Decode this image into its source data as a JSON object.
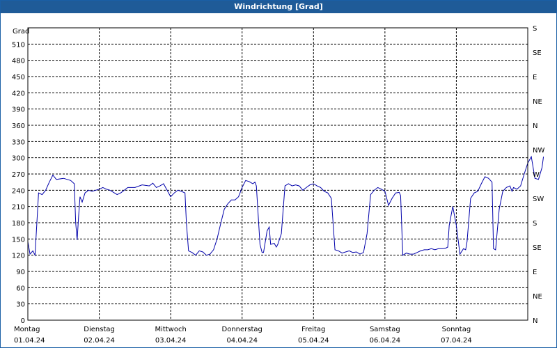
{
  "window": {
    "title": "Windrichtung [Grad]"
  },
  "chart_data": {
    "type": "line",
    "title": "Windrichtung [Grad]",
    "ylabel": "Grad",
    "ylim": [
      0,
      540
    ],
    "y_ticks": [
      0,
      30,
      60,
      90,
      120,
      150,
      180,
      210,
      240,
      270,
      300,
      330,
      360,
      390,
      420,
      450,
      480,
      510
    ],
    "y2_ticks": [
      {
        "value": 0,
        "label": "N"
      },
      {
        "value": 45,
        "label": "NE"
      },
      {
        "value": 90,
        "label": "E"
      },
      {
        "value": 135,
        "label": "SE"
      },
      {
        "value": 180,
        "label": "S"
      },
      {
        "value": 225,
        "label": "SW"
      },
      {
        "value": 270,
        "label": "W"
      },
      {
        "value": 315,
        "label": "NW"
      },
      {
        "value": 360,
        "label": "N"
      },
      {
        "value": 405,
        "label": "NE"
      },
      {
        "value": 450,
        "label": "E"
      },
      {
        "value": 495,
        "label": "SE"
      },
      {
        "value": 540,
        "label": "S"
      }
    ],
    "x_range": [
      0,
      7
    ],
    "x_ticks": [
      {
        "day": "Montag",
        "date": "01.04.24"
      },
      {
        "day": "Dienstag",
        "date": "02.04.24"
      },
      {
        "day": "Mittwoch",
        "date": "03.04.24"
      },
      {
        "day": "Donnerstag",
        "date": "04.04.24"
      },
      {
        "day": "Freitag",
        "date": "05.04.24"
      },
      {
        "day": "Samstag",
        "date": "06.04.24"
      },
      {
        "day": "Sonntag",
        "date": "07.04.24"
      }
    ],
    "grid": true,
    "series": [
      {
        "color": "#0000aa",
        "points": [
          [
            0.0,
            145
          ],
          [
            0.03,
            122
          ],
          [
            0.07,
            128
          ],
          [
            0.1,
            120
          ],
          [
            0.15,
            235
          ],
          [
            0.2,
            232
          ],
          [
            0.25,
            240
          ],
          [
            0.3,
            255
          ],
          [
            0.35,
            268
          ],
          [
            0.4,
            260
          ],
          [
            0.5,
            262
          ],
          [
            0.6,
            258
          ],
          [
            0.65,
            252
          ],
          [
            0.67,
            180
          ],
          [
            0.69,
            148
          ],
          [
            0.71,
            190
          ],
          [
            0.73,
            228
          ],
          [
            0.76,
            218
          ],
          [
            0.8,
            235
          ],
          [
            0.85,
            240
          ],
          [
            0.9,
            238
          ],
          [
            1.0,
            242
          ],
          [
            1.05,
            245
          ],
          [
            1.1,
            242
          ],
          [
            1.15,
            240
          ],
          [
            1.2,
            236
          ],
          [
            1.25,
            232
          ],
          [
            1.3,
            235
          ],
          [
            1.35,
            240
          ],
          [
            1.4,
            245
          ],
          [
            1.5,
            245
          ],
          [
            1.6,
            250
          ],
          [
            1.7,
            248
          ],
          [
            1.75,
            253
          ],
          [
            1.8,
            245
          ],
          [
            1.85,
            248
          ],
          [
            1.9,
            252
          ],
          [
            1.95,
            240
          ],
          [
            2.0,
            228
          ],
          [
            2.05,
            235
          ],
          [
            2.1,
            240
          ],
          [
            2.15,
            238
          ],
          [
            2.2,
            235
          ],
          [
            2.22,
            180
          ],
          [
            2.25,
            128
          ],
          [
            2.3,
            125
          ],
          [
            2.35,
            120
          ],
          [
            2.4,
            128
          ],
          [
            2.45,
            126
          ],
          [
            2.5,
            120
          ],
          [
            2.55,
            122
          ],
          [
            2.6,
            130
          ],
          [
            2.65,
            150
          ],
          [
            2.7,
            178
          ],
          [
            2.75,
            205
          ],
          [
            2.8,
            215
          ],
          [
            2.85,
            222
          ],
          [
            2.9,
            222
          ],
          [
            2.95,
            228
          ],
          [
            3.0,
            245
          ],
          [
            3.05,
            258
          ],
          [
            3.1,
            256
          ],
          [
            3.15,
            252
          ],
          [
            3.18,
            255
          ],
          [
            3.2,
            248
          ],
          [
            3.25,
            140
          ],
          [
            3.28,
            125
          ],
          [
            3.3,
            125
          ],
          [
            3.35,
            165
          ],
          [
            3.38,
            172
          ],
          [
            3.4,
            140
          ],
          [
            3.45,
            142
          ],
          [
            3.48,
            135
          ],
          [
            3.5,
            140
          ],
          [
            3.55,
            160
          ],
          [
            3.6,
            248
          ],
          [
            3.65,
            252
          ],
          [
            3.7,
            248
          ],
          [
            3.75,
            250
          ],
          [
            3.8,
            248
          ],
          [
            3.85,
            240
          ],
          [
            3.9,
            245
          ],
          [
            3.95,
            250
          ],
          [
            4.0,
            252
          ],
          [
            4.05,
            248
          ],
          [
            4.1,
            245
          ],
          [
            4.15,
            238
          ],
          [
            4.2,
            235
          ],
          [
            4.25,
            225
          ],
          [
            4.3,
            130
          ],
          [
            4.35,
            128
          ],
          [
            4.4,
            124
          ],
          [
            4.45,
            126
          ],
          [
            4.5,
            128
          ],
          [
            4.55,
            125
          ],
          [
            4.6,
            126
          ],
          [
            4.65,
            122
          ],
          [
            4.7,
            125
          ],
          [
            4.75,
            160
          ],
          [
            4.8,
            232
          ],
          [
            4.85,
            240
          ],
          [
            4.9,
            245
          ],
          [
            4.95,
            242
          ],
          [
            5.0,
            238
          ],
          [
            5.05,
            212
          ],
          [
            5.1,
            225
          ],
          [
            5.15,
            235
          ],
          [
            5.2,
            236
          ],
          [
            5.22,
            230
          ],
          [
            5.25,
            120
          ],
          [
            5.3,
            124
          ],
          [
            5.35,
            122
          ],
          [
            5.4,
            122
          ],
          [
            5.45,
            125
          ],
          [
            5.5,
            128
          ],
          [
            5.55,
            130
          ],
          [
            5.6,
            130
          ],
          [
            5.65,
            132
          ],
          [
            5.7,
            130
          ],
          [
            5.75,
            132
          ],
          [
            5.8,
            132
          ],
          [
            5.85,
            133
          ],
          [
            5.88,
            135
          ],
          [
            5.9,
            175
          ],
          [
            5.95,
            210
          ],
          [
            6.0,
            175
          ],
          [
            6.05,
            122
          ],
          [
            6.1,
            132
          ],
          [
            6.13,
            130
          ],
          [
            6.15,
            145
          ],
          [
            6.2,
            225
          ],
          [
            6.25,
            235
          ],
          [
            6.3,
            238
          ],
          [
            6.35,
            252
          ],
          [
            6.4,
            265
          ],
          [
            6.45,
            262
          ],
          [
            6.5,
            255
          ],
          [
            6.52,
            132
          ],
          [
            6.55,
            130
          ],
          [
            6.6,
            205
          ],
          [
            6.65,
            238
          ],
          [
            6.7,
            245
          ],
          [
            6.75,
            248
          ],
          [
            6.78,
            238
          ],
          [
            6.8,
            245
          ],
          [
            6.85,
            242
          ],
          [
            6.9,
            248
          ],
          [
            6.95,
            270
          ],
          [
            7.0,
            290
          ],
          [
            7.05,
            302
          ],
          [
            7.1,
            262
          ],
          [
            7.15,
            260
          ],
          [
            7.2,
            282
          ],
          [
            7.22,
            302
          ]
        ]
      }
    ]
  }
}
